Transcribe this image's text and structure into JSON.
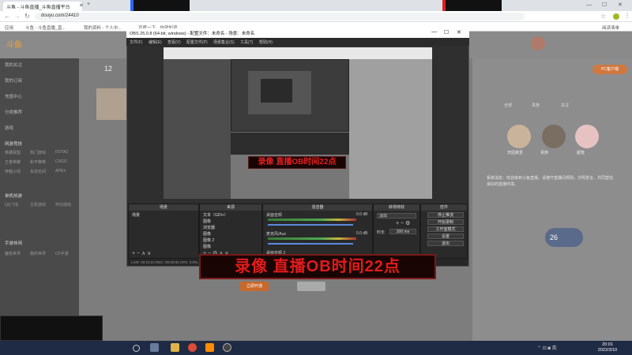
{
  "browser": {
    "tabs": [
      {
        "label": "斗鱼 - 斗鱼直播_斗鱼直播平台"
      },
      {
        "label": ""
      }
    ],
    "url": "douyu.com/24410",
    "bookmarks": [
      "应用",
      "斗鱼 - 斗鱼直播_直...",
      "我的资料 - 个人中...",
      "百度一下，你就知道"
    ],
    "bookmarks_right": "阅读清单"
  },
  "douyu": {
    "logo": "斗鱼",
    "counter": "12",
    "sidebar": {
      "items": [
        "我的关注",
        "我的订阅",
        "充值中心",
        "分类推荐",
        "游戏"
      ],
      "section_headers": [
        "网游竞技",
        "单机热游",
        "手游休闲"
      ],
      "grid": [
        [
          "英雄联盟",
          "热门游戏",
          "DOTA2"
        ],
        [
          "王者荣耀",
          "和平精英",
          "CSGO"
        ],
        [
          "穿越火线",
          "永劫无间",
          "APEX"
        ],
        [
          "QQ飞车",
          "主机游戏",
          "怀旧游戏"
        ],
        [
          "魔兽世界",
          "我的世界",
          "CF手游"
        ]
      ]
    },
    "right_panel": {
      "btn": "PC客户端",
      "tags": [
        "全部",
        "贵族",
        "关注"
      ],
      "fans": [
        "天团真爱",
        "贵族",
        "超管"
      ],
      "level": "26",
      "chat": "系统消息：欢迎来到斗鱼直播，请遵守直播间规则，文明发言，共同营造良好的直播环境。"
    },
    "action_btn": "立即开通"
  },
  "obs": {
    "title": "OBS 25.0.8 (64-bit, windows) - 配置文件：未命名 - 场景：未命名",
    "menu": [
      "文件(F)",
      "编辑(E)",
      "查看(V)",
      "配置文件(P)",
      "场景集合(S)",
      "工具(T)",
      "帮助(H)"
    ],
    "panels": {
      "scenes": "场景",
      "sources": "来源",
      "mixer": "混音器",
      "transitions": "转场特效",
      "controls": "控件"
    },
    "scene_items": [
      "场景"
    ],
    "source_items": [
      "文本（GDI+）",
      "图像",
      "浏览器",
      "图像",
      "图像 2",
      "图像"
    ],
    "mixer_items": [
      {
        "name": "桌面音频",
        "db": "0.0 dB"
      },
      {
        "name": "麦克风/Aux",
        "db": "0.0 dB"
      },
      {
        "name": "桌面音频 2",
        "db": "0.0 dB"
      }
    ],
    "transition": {
      "type": "淡出",
      "duration_label": "时长",
      "duration": "300 ms"
    },
    "control_buttons": [
      "停止推流",
      "开始录制",
      "工作室模式",
      "设置",
      "退出"
    ],
    "status": "LIVE: 00:10:24  REC: 00:00:00  CPU: 3.9%, 30.00 fps",
    "preview_overlay": "录像 直播OB时间22点"
  },
  "overlay_text": "录像 直播OB时间22点",
  "taskbar": {
    "time": "20:01",
    "date": "2022/3/10"
  },
  "colors": {
    "overlay_red": "#e31b1b",
    "douyu_orange": "#ff7800",
    "obs_dark": "#2f2f2f"
  }
}
